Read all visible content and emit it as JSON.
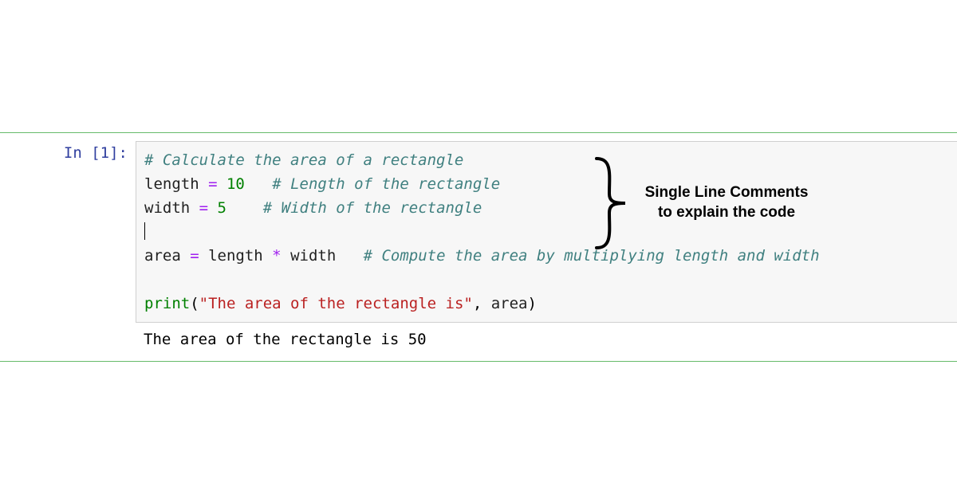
{
  "cell": {
    "prompt": "In [1]:",
    "code": {
      "line1_comment": "# Calculate the area of a rectangle",
      "line2_var": "length",
      "line2_op": " = ",
      "line2_num": "10",
      "line2_space": "   ",
      "line2_comment": "# Length of the rectangle",
      "line3_var": "width",
      "line3_op": " = ",
      "line3_num": "5",
      "line3_space": "    ",
      "line3_comment": "# Width of the rectangle",
      "line5_var": "area",
      "line5_op": " = ",
      "line5_expr_a": "length",
      "line5_mul": " * ",
      "line5_expr_b": "width",
      "line5_space": "   ",
      "line5_comment": "# Compute the area by multiplying length and width",
      "line7_func": "print",
      "line7_open": "(",
      "line7_str": "\"The area of the rectangle is\"",
      "line7_comma": ", ",
      "line7_arg": "area",
      "line7_close": ")"
    },
    "output": "The area of the rectangle is 50"
  },
  "annotation": {
    "line1": "Single Line Comments",
    "line2": "to explain the code"
  }
}
